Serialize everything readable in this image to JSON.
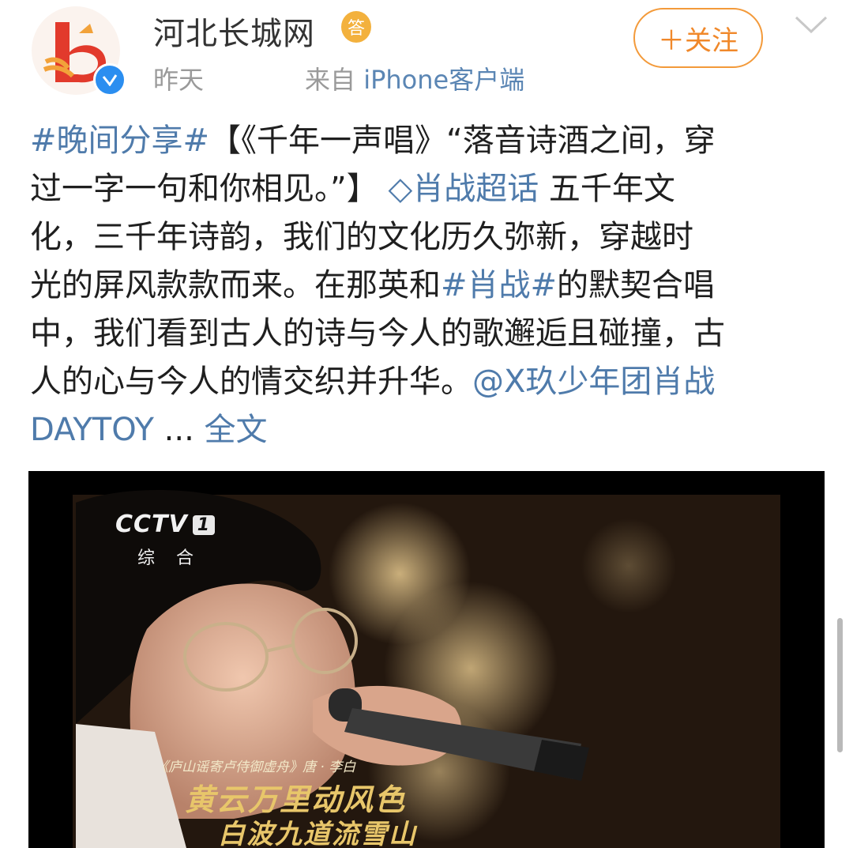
{
  "header": {
    "account_name": "河北长城网",
    "medal_glyph": "答",
    "time": "昨天",
    "source_prefix": "来自",
    "source_device": "iPhone客户端",
    "follow_label": "＋关注"
  },
  "post": {
    "lines": [
      [
        {
          "t": "#晚间分享#",
          "link": true
        },
        {
          "t": "【《千年一声唱》“落音诗酒之间，穿"
        }
      ],
      [
        {
          "t": "过一字一句和你相见。”】 "
        },
        {
          "t": "◇肖战超话",
          "link": true
        },
        {
          "t": "  五千年文"
        }
      ],
      [
        {
          "t": "化，三千年诗韵，我们的文化历久弥新，穿越时"
        }
      ],
      [
        {
          "t": "光的屏风款款而来。在那英和"
        },
        {
          "t": "#肖战#",
          "link": true
        },
        {
          "t": "的默契合唱"
        }
      ],
      [
        {
          "t": "中，我们看到古人的诗与今人的歌邂逅且碰撞，古"
        }
      ],
      [
        {
          "t": "人的心与今人的情交织并升华。"
        },
        {
          "t": "@X玖少年团肖战",
          "link": true
        }
      ],
      [
        {
          "t": "DAYTOY ",
          "link": true
        },
        {
          "t": " ... "
        },
        {
          "t": "全文",
          "link": true
        }
      ]
    ]
  },
  "video": {
    "channel_logo": "CCTV",
    "channel_number": "1",
    "channel_name": "综 合",
    "poem_title": "《庐山谣寄卢侍御虚舟》唐 · 李白",
    "lyric_line1": "黄云万里动风色",
    "lyric_line2": "白波九道流雪山"
  },
  "colors": {
    "link": "#4f7bab",
    "follow": "#f0882a",
    "verified": "#2b8ef0"
  }
}
